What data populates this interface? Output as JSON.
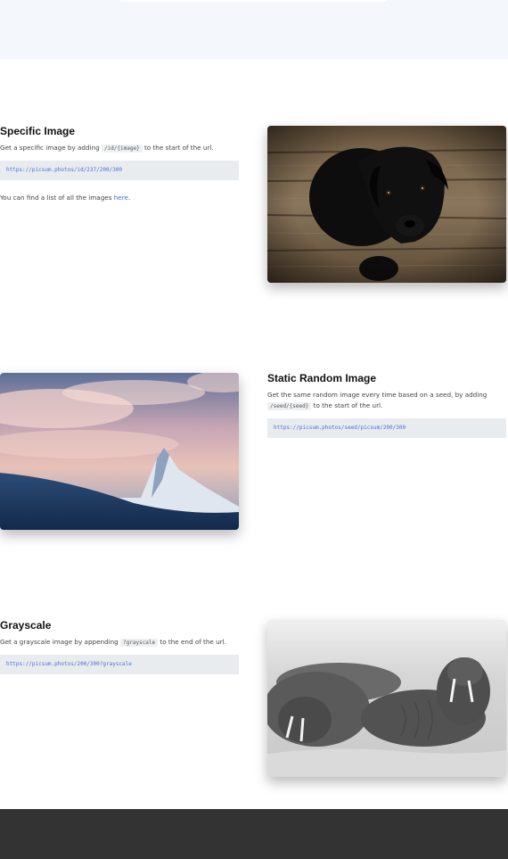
{
  "sections": {
    "specific": {
      "title": "Specific Image",
      "desc_before": "Get a specific image by adding ",
      "code_inline": "/id/{image}",
      "desc_after": " to the start of the url.",
      "code_example": "https://picsum.photos/id/237/200/300",
      "list_before": "You can find a list of all the images ",
      "list_link": "here",
      "list_after": "."
    },
    "static_random": {
      "title": "Static Random Image",
      "desc_before": "Get the same random image every time based on a seed, by adding ",
      "code_inline": "/seed/{seed}",
      "desc_after": " to the start of the url.",
      "code_example": "https://picsum.photos/seed/picsum/200/300"
    },
    "grayscale": {
      "title": "Grayscale",
      "desc_before": "Get a grayscale image by appending ",
      "code_inline": "?grayscale",
      "desc_after": " to the end of the url.",
      "code_example": "https://picsum.photos/200/300?grayscale"
    }
  },
  "colors": {
    "hero_background": "#f4f7fc",
    "code_background": "#e9ecef",
    "code_text": "#4a6fd8",
    "link": "#3b6fd6",
    "footer": "#333333"
  }
}
